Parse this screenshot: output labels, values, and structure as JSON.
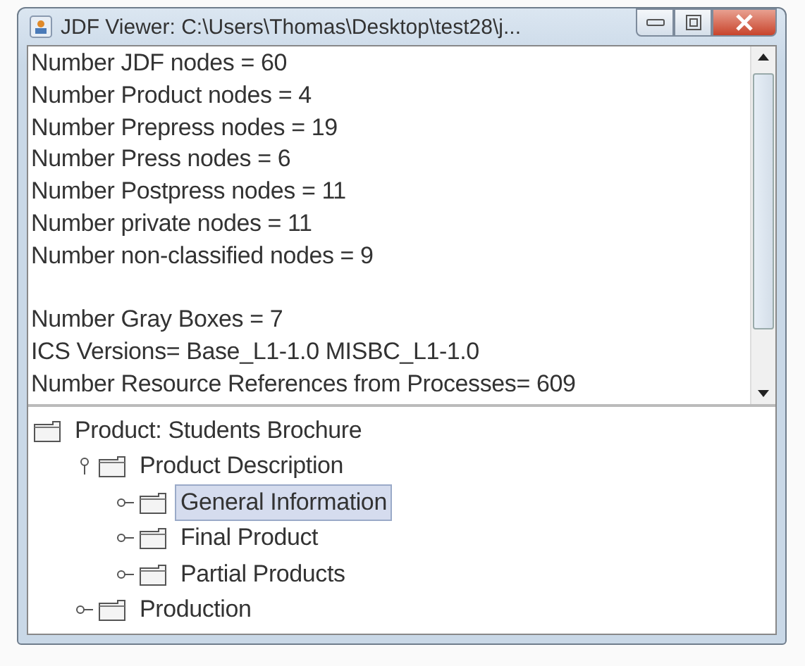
{
  "window": {
    "title": "JDF Viewer: C:\\Users\\Thomas\\Desktop\\test28\\j..."
  },
  "summary": {
    "paragraphs": [
      [
        "Number JDF nodes = 60",
        "Number Product nodes = 4",
        "Number Prepress nodes = 19",
        "Number Press nodes = 6",
        "Number Postpress nodes = 11",
        "Number private nodes = 11",
        "Number non-classified nodes = 9"
      ],
      [
        "Number Gray Boxes = 7",
        "ICS Versions= Base_L1-1.0 MISBC_L1-1.0",
        "Number Resource References from Processes= 609"
      ]
    ]
  },
  "tree": {
    "root": {
      "label": "Product: Students Brochure",
      "selected": false,
      "children": [
        {
          "label": "Product Description",
          "expanded": true,
          "selected": false,
          "children": [
            {
              "label": "General Information",
              "expanded": false,
              "selected": true
            },
            {
              "label": "Final Product",
              "expanded": false,
              "selected": false
            },
            {
              "label": "Partial Products",
              "expanded": false,
              "selected": false
            }
          ]
        },
        {
          "label": "Production",
          "expanded": false,
          "selected": false
        }
      ]
    }
  }
}
